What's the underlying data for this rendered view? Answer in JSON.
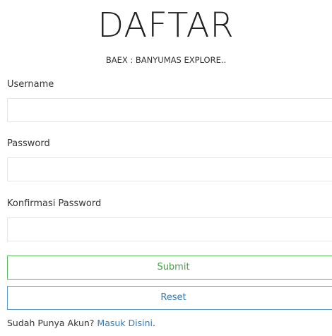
{
  "header": {
    "title": "DAFTAR",
    "subtitle": "BAEX : BANYUMAS EXPLORE.."
  },
  "form": {
    "username": {
      "label": "Username",
      "value": "",
      "placeholder": ""
    },
    "password": {
      "label": "Password",
      "value": "",
      "placeholder": ""
    },
    "confirm_password": {
      "label": "Konfirmasi Password",
      "value": "",
      "placeholder": ""
    },
    "submit_label": "Submit",
    "reset_label": "Reset"
  },
  "footer": {
    "prompt": "Sudah Punya Akun? ",
    "link_text": "Masuk Disini",
    "trailing": "."
  },
  "colors": {
    "submit_border": "#5cb85c",
    "reset_border": "#5b9bd5",
    "link": "#337ab7"
  }
}
